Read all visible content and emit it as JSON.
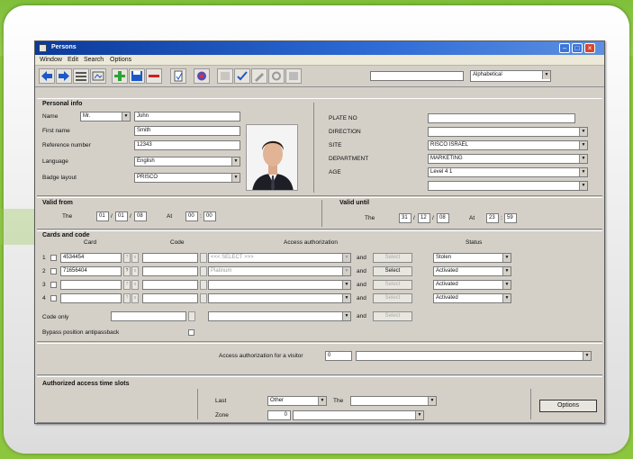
{
  "window": {
    "title": "Persons",
    "icon": "app-icon"
  },
  "window_buttons": [
    "minimize-icon",
    "maximize-icon",
    "close-icon"
  ],
  "menu": [
    "Window",
    "Edit",
    "Search",
    "Options"
  ],
  "toolbar": {
    "buttons": [
      "back-arrow-icon",
      "forward-arrow-icon",
      "list-icon",
      "view-icon",
      "add-icon",
      "save-icon",
      "delete-icon",
      "report-icon",
      "print-icon",
      "blank-icon",
      "checklist-icon",
      "edit-icon",
      "tools-icon",
      "grid-icon"
    ],
    "sort_value": "Alphabetical"
  },
  "personal_info": {
    "heading": "Personal info",
    "name_label": "Name",
    "title_value": "Mr.",
    "name_value": "John",
    "first_name_label": "First name",
    "first_name_value": "Smith",
    "reference_label": "Reference number",
    "reference_value": "12343",
    "language_label": "Language",
    "language_value": "English",
    "badge_label": "Badge layout",
    "badge_value": "PRISCO",
    "plate_label": "PLATE NO",
    "direction_label": "DIRECTION",
    "site_label": "SITE",
    "site_value": "RISCO ISRAEL",
    "department_label": "DEPARTMENT",
    "department_value": "MARKETING",
    "age_label": "AGE",
    "age_value": "Level 4 1"
  },
  "validity": {
    "from_label": "Valid from",
    "the_label": "The",
    "from_day": "01",
    "from_month": "01",
    "from_year": "08",
    "at_label": "At",
    "from_hour": "00",
    "from_min": "00",
    "until_label": "Valid until",
    "until_day": "31",
    "until_month": "12",
    "until_year": "08",
    "until_at_label": "At",
    "until_hour": "23",
    "until_min": "59"
  },
  "cards": {
    "heading": "Cards and code",
    "col_card": "Card",
    "col_code": "Code",
    "col_access": "Access authorization",
    "col_status": "Status",
    "rows": [
      {
        "num": "1",
        "card": "4534454",
        "access": "<<< SELECT >>>",
        "and": "and",
        "select": "Select",
        "status": "Stolen"
      },
      {
        "num": "2",
        "card": "71656404",
        "access": "Platinum",
        "and": "and",
        "select": "Select",
        "status": "Activated"
      },
      {
        "num": "3",
        "card": "",
        "access": "",
        "and": "and",
        "select": "Select",
        "status": "Activated"
      },
      {
        "num": "4",
        "card": "",
        "access": "",
        "and": "and",
        "select": "Select",
        "status": "Activated"
      }
    ],
    "code_only_label": "Code only",
    "code_only_and": "and",
    "code_only_select": "Select",
    "bypass_label": "Bypass position antipassback"
  },
  "visitor": {
    "label": "Access authorization for a visitor",
    "value": "0"
  },
  "timeslots": {
    "heading": "Authorized access time slots",
    "last_label": "Last",
    "last_value": "Other",
    "the_label": "The",
    "zone_label": "Zone",
    "zone_value": "0",
    "options_button": "Options"
  }
}
